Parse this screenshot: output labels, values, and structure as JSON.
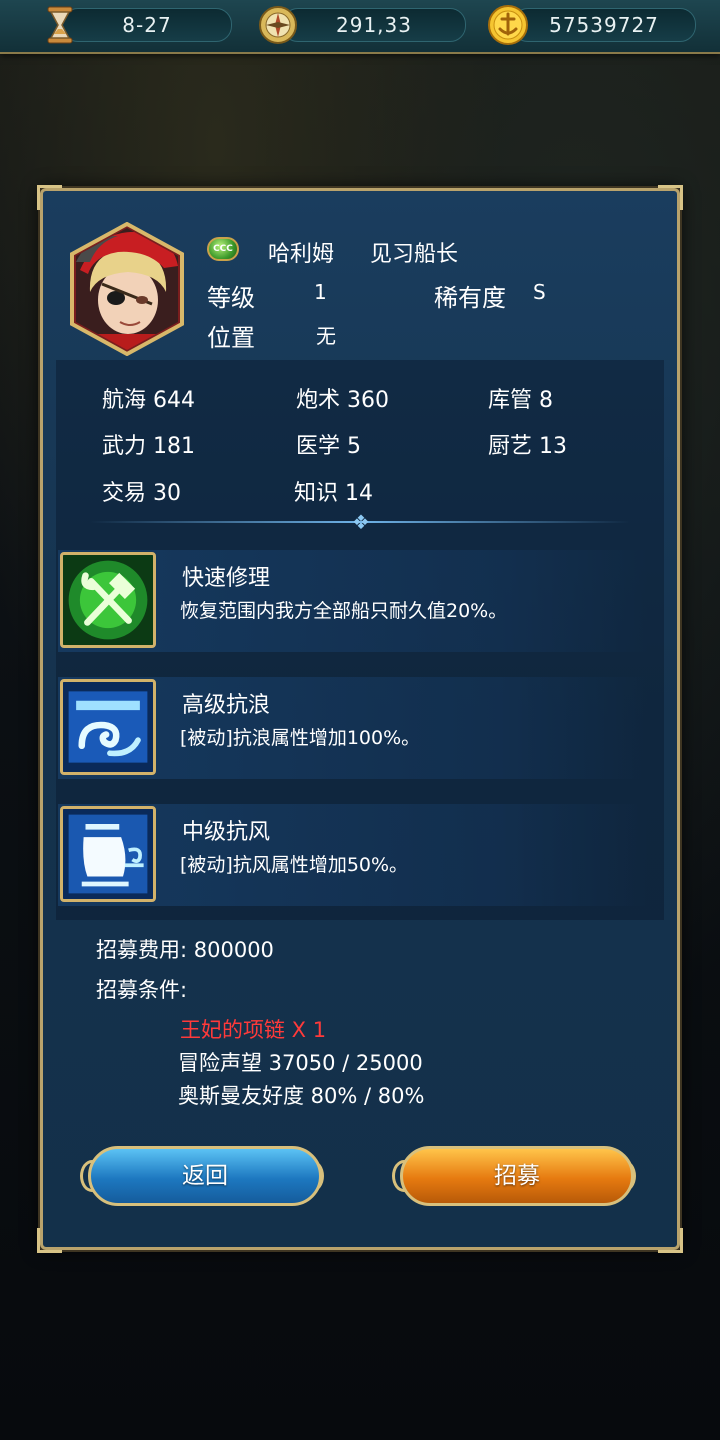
{
  "topbar": {
    "date": "8-27",
    "compass_value": "291,33",
    "gold": "57539727"
  },
  "officer": {
    "rank_badge": "CCC",
    "name": "哈利姆",
    "title": "见习船长",
    "level_label": "等级",
    "level_value": "1",
    "rarity_label": "稀有度",
    "rarity_value": "S",
    "position_label": "位置",
    "position_value": "无"
  },
  "stats": [
    {
      "label": "航海 644"
    },
    {
      "label": "炮术 360"
    },
    {
      "label": "库管 8"
    },
    {
      "label": "武力 181"
    },
    {
      "label": "医学 5"
    },
    {
      "label": "厨艺 13"
    },
    {
      "label": "交易 30"
    },
    {
      "label": "知识 14"
    }
  ],
  "skills": [
    {
      "name": "快速修理",
      "desc": "恢复范围内我方全部船只耐久值20%。",
      "icon": "repair-tools-icon"
    },
    {
      "name": "高级抗浪",
      "desc": "[被动]抗浪属性增加100%。",
      "icon": "wave-icon"
    },
    {
      "name": "中级抗风",
      "desc": "[被动]抗风属性增加50%。",
      "icon": "sail-wind-icon"
    }
  ],
  "recruit": {
    "cost_text": "招募费用: 800000",
    "conditions_label": "招募条件:",
    "conditions": [
      {
        "text": "王妃的项链 X 1",
        "color": "#ff3a3a"
      },
      {
        "text": "冒险声望 37050 / 25000",
        "color": "#ffffff"
      },
      {
        "text": "奥斯曼友好度 80% / 80%",
        "color": "#ffffff"
      }
    ]
  },
  "buttons": {
    "back": "返回",
    "recruit": "招募"
  }
}
